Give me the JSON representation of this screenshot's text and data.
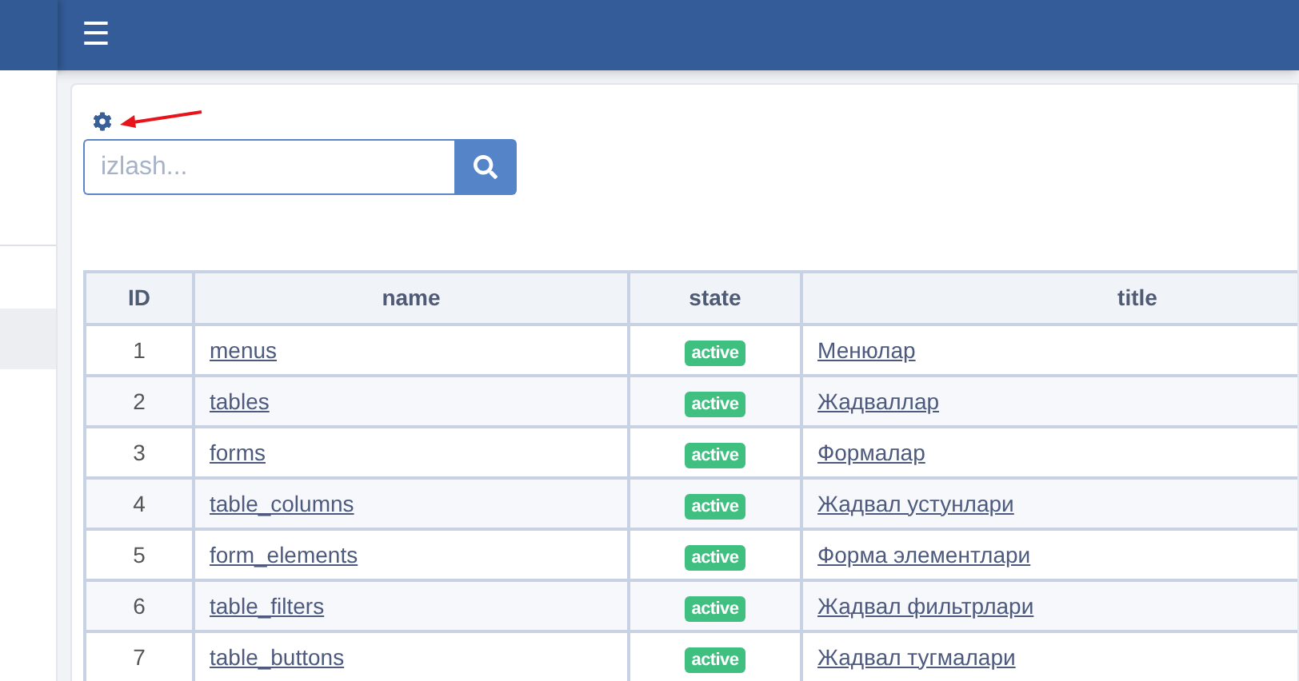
{
  "topbar": {
    "menu_glyph": "☰"
  },
  "search": {
    "placeholder": "izlash..."
  },
  "table": {
    "columns": [
      "ID",
      "name",
      "state",
      "title"
    ],
    "rows": [
      {
        "id": "1",
        "name": "menus",
        "state": "active",
        "title": "Менюлар"
      },
      {
        "id": "2",
        "name": "tables",
        "state": "active",
        "title": "Жадваллар"
      },
      {
        "id": "3",
        "name": "forms",
        "state": "active",
        "title": "Формалар"
      },
      {
        "id": "4",
        "name": "table_columns",
        "state": "active",
        "title": "Жадвал устунлари"
      },
      {
        "id": "5",
        "name": "form_elements",
        "state": "active",
        "title": "Форма элементлари"
      },
      {
        "id": "6",
        "name": "table_filters",
        "state": "active",
        "title": "Жадвал фильтрлари"
      },
      {
        "id": "7",
        "name": "table_buttons",
        "state": "active",
        "title": "Жадвал тугмалари"
      }
    ]
  }
}
